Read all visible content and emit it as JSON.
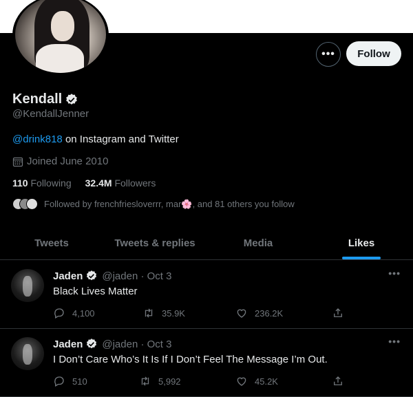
{
  "profile": {
    "name": "Kendall",
    "handle": "@KendallJenner",
    "bio_mention": "@drink818",
    "bio_rest": " on Instagram and Twitter",
    "joined": "Joined June 2010",
    "following_count": "110",
    "following_label": "Following",
    "followers_count": "32.4M",
    "followers_label": "Followers",
    "followed_by": "Followed by frenchfriesloverrr, mar🌸, and 81 others you follow"
  },
  "actions": {
    "more_glyph": "•••",
    "follow_label": "Follow"
  },
  "tabs": [
    {
      "label": "Tweets"
    },
    {
      "label": "Tweets & replies"
    },
    {
      "label": "Media"
    },
    {
      "label": "Likes",
      "active": true
    }
  ],
  "tweets": [
    {
      "name": "Jaden",
      "meta": "@jaden · Oct 3",
      "text": "Black Lives Matter",
      "replies": "4,100",
      "retweets": "35.9K",
      "likes": "236.2K"
    },
    {
      "name": "Jaden",
      "meta": "@jaden · Oct 3",
      "text": "I Don’t Care Who’s It Is If I Don’t Feel The Message I’m Out.",
      "replies": "510",
      "retweets": "5,992",
      "likes": "45.2K"
    }
  ],
  "colors": {
    "background": "#000000",
    "accent": "#1d9bf0",
    "muted_text": "#71767b",
    "primary_text": "#e7e9ea"
  }
}
